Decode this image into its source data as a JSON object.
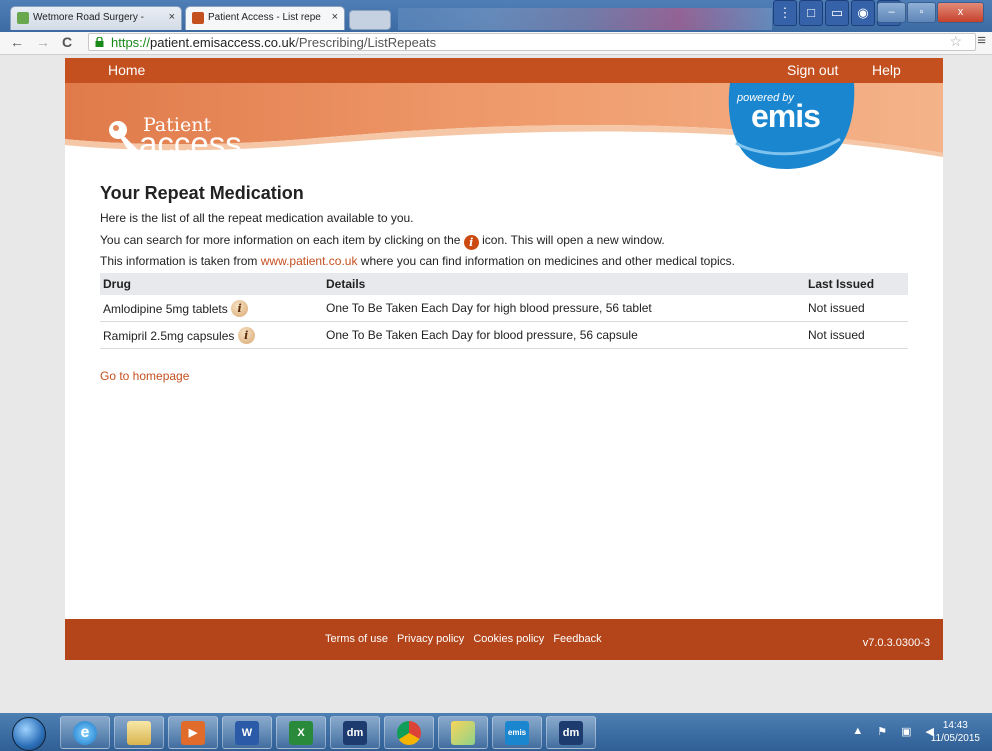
{
  "browser": {
    "tabs": [
      {
        "title": "Wetmore Road Surgery - "
      },
      {
        "title": "Patient Access  - List repe"
      }
    ],
    "tab_close_glyph": "×",
    "window_controls": [
      "–",
      "▫",
      "x"
    ],
    "url": {
      "scheme": "https://",
      "host": "patient.emisaccess.co.uk",
      "path": "/Prescribing/ListRepeats"
    },
    "icons": [
      "back-arrow-icon",
      "forward-arrow-icon",
      "reload-icon",
      "lock-icon",
      "star-icon",
      "menu-icon"
    ]
  },
  "site": {
    "nav": {
      "home": "Home",
      "sign_out": "Sign out",
      "help": "Help"
    },
    "logo": {
      "line1": "Patient",
      "line2": "access"
    },
    "emis": {
      "powered_by": "powered by",
      "brand": "emis"
    }
  },
  "main": {
    "title": "Your Repeat Medication",
    "intro1": "Here is the list of all the repeat medication available to you.",
    "intro2_before": "You can search for more information on each item by clicking on the",
    "intro2_after": "icon. This will open a new window.",
    "intro3_before": "This information is taken from",
    "intro3_link": "www.patient.co.uk",
    "intro3_after": "where you can find information on medicines and other medical topics.",
    "info_glyph": "i",
    "table": {
      "headers": {
        "drug": "Drug",
        "details": "Details",
        "last_issued": "Last Issued"
      },
      "rows": [
        {
          "drug": "Amlodipine 5mg tablets",
          "details": "One To Be Taken Each Day for high blood pressure, 56 tablet",
          "last_issued": "Not issued"
        },
        {
          "drug": "Ramipril 2.5mg capsules",
          "details": "One To Be Taken Each Day for blood pressure, 56 capsule",
          "last_issued": "Not issued"
        }
      ]
    },
    "home_link": "Go to homepage"
  },
  "footer": {
    "links": [
      "Terms of use",
      "Privacy policy",
      "Cookies policy",
      "Feedback"
    ],
    "version": "v7.0.3.0300-3"
  },
  "taskbar": {
    "apps": [
      "internet-explorer",
      "file-explorer",
      "media-player",
      "word",
      "excel",
      "dm",
      "chrome",
      "folder",
      "emis-web",
      "dm"
    ],
    "app_labels": {
      "word": "W",
      "excel": "X",
      "dm": "dm",
      "emis": "emis\nWeb"
    },
    "clock": {
      "time": "14:43",
      "date": "11/05/2015"
    }
  },
  "colors": {
    "brand_orange": "#c4501f",
    "footer_orange": "#b4441a",
    "emis_blue": "#1a86cf",
    "link": "#c4501f"
  }
}
